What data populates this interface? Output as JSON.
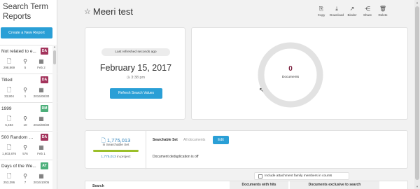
{
  "sidebar": {
    "title": "Search Term Reports",
    "create_button": "Create a New Report",
    "items": [
      {
        "name": "Not related to e...",
        "badge": "DA",
        "badge_color": "#a3345c",
        "docs": "298,869",
        "searches": "5",
        "date": "Feb 2"
      },
      {
        "name": "Titled",
        "badge": "DA",
        "badge_color": "#a3345c",
        "docs": "33,904",
        "searches": "1",
        "date": "2016/08/30"
      },
      {
        "name": "1999",
        "badge": "RM",
        "badge_color": "#4caf7a",
        "docs": "5,483",
        "searches": "10",
        "date": "2016/08/30"
      },
      {
        "name": "500 Random W...",
        "badge": "DA",
        "badge_color": "#a3345c",
        "docs": "1,603,876",
        "searches": "576",
        "date": "Feb 1"
      },
      {
        "name": "Days of the We...",
        "badge": "AY",
        "badge_color": "#4caf7a",
        "docs": "253,396",
        "searches": "7",
        "date": "2016/10/05"
      }
    ]
  },
  "header": {
    "title": "Meeri test",
    "toolbar": [
      {
        "label": "Copy",
        "icon": "copy-icon",
        "glyph": "⎘"
      },
      {
        "label": "Download",
        "icon": "download-icon",
        "glyph": "⤓"
      },
      {
        "label": "Binder",
        "icon": "binder-icon",
        "glyph": "↗"
      },
      {
        "label": "Share",
        "icon": "share-icon",
        "glyph": "⋲"
      },
      {
        "label": "Delete",
        "icon": "delete-icon",
        "glyph": "🗑"
      }
    ]
  },
  "date_card": {
    "refreshed": "Last refreshed seconds ago",
    "date": "February 15, 2017",
    "time": "3:38 pm",
    "refresh_button": "Refresh Search Values"
  },
  "donut": {
    "value": "0",
    "label": "Documents",
    "fraction": 0
  },
  "set_card": {
    "count": "1,775,013",
    "count_label": "in Searchable Set",
    "project_count": "1,775,013",
    "project_label": "in project",
    "searchable_set_label": "Searchable Set",
    "searchable_set_value": "All documents",
    "edit_button": "Edit",
    "dedup_text": "Document deduplication is off"
  },
  "include_family_label": "Include attachment family members in counts",
  "results_header": {
    "search": "Search",
    "hits": "Documents with hits",
    "exclusive": "Documents exclusive to search"
  },
  "colors": {
    "accent": "#2a9fd6",
    "donut_track": "#e2e2e2",
    "count_bar": "#9bbf2a",
    "donut_value": "#7a1f3d"
  }
}
